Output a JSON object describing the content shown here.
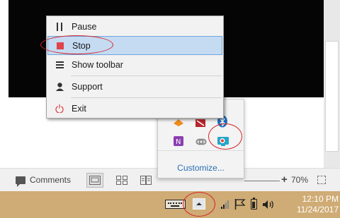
{
  "context_menu": {
    "items": [
      {
        "label": "Pause",
        "icon": "pause-icon"
      },
      {
        "label": "Stop",
        "icon": "stop-icon",
        "highlighted": true
      },
      {
        "label": "Show toolbar",
        "icon": "toolbar-icon"
      },
      {
        "label": "Support",
        "icon": "person-icon"
      },
      {
        "label": "Exit",
        "icon": "power-icon"
      }
    ]
  },
  "tray_overflow": {
    "customize_label": "Customize...",
    "apps": [
      "orange-app-icon",
      "red-app-icon",
      "bluetooth-icon",
      "onenote-icon",
      "link-icon",
      "screen-recorder-icon"
    ]
  },
  "status_bar": {
    "comments_label": "Comments",
    "zoom_plus": "+",
    "zoom_level": "70%"
  },
  "taskbar": {
    "time": "12:10 PM",
    "date": "11/24/2017"
  },
  "colors": {
    "taskbar": "#cfac75",
    "menu_highlight": "#c5dbf2",
    "annotation": "#d6242a",
    "link": "#2a6fb4"
  }
}
